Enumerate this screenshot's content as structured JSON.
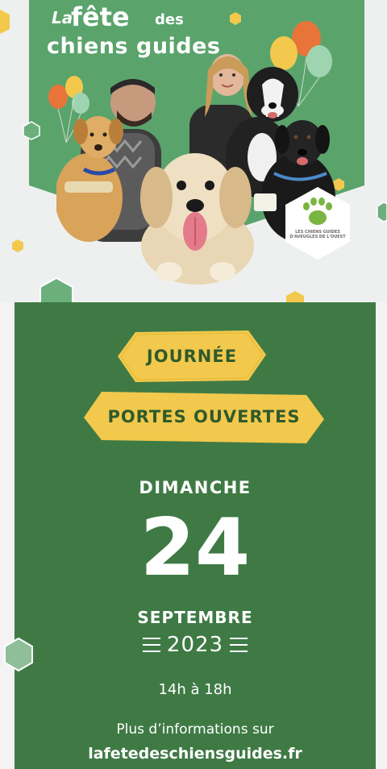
{
  "poster_top": {
    "title_la": "La",
    "title_fete": "fête",
    "title_des": "des",
    "title_chiens_guides": "chiens guides",
    "logo_text": "LES CHIENS GUIDES D'AVEUGLES DE L'OUEST"
  },
  "poster_bottom": {
    "ribbon_1": "JOURNÉE",
    "ribbon_2": "PORTES OUVERTES",
    "day": "DIMANCHE",
    "date": "24",
    "month": "SEPTEMBRE",
    "year": "2023",
    "hours": "14h à 18h",
    "info": "Plus d’informations sur",
    "website": "lafetedeschiensguides.fr"
  },
  "colors": {
    "green_dark": "#3f7a45",
    "green_light": "#5aa46c",
    "yellow": "#f2c94c",
    "orange": "#e8743a"
  }
}
